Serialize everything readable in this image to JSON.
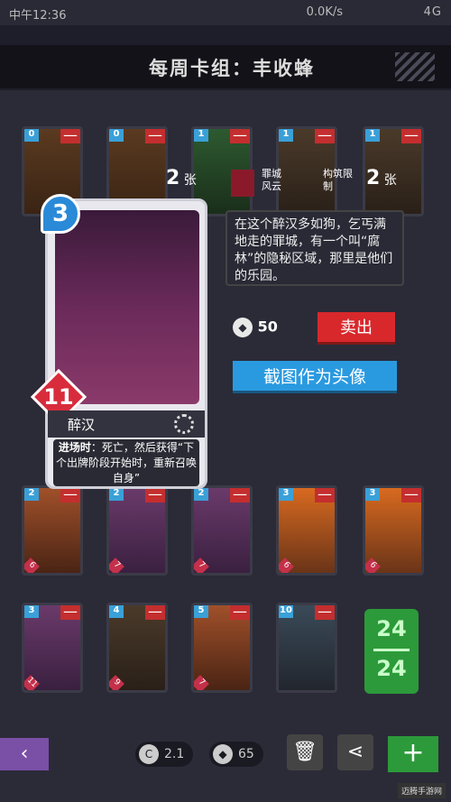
{
  "status": {
    "time": "中午12:36",
    "net": "0.0K/s",
    "right": "4G"
  },
  "title": "每周卡组：丰收蜂",
  "info": {
    "count1": "2",
    "count1_unit": "张",
    "faction": "罪城风云",
    "limit": "构筑限制",
    "count2": "2",
    "count2_unit": "张"
  },
  "card": {
    "cost": "3",
    "power": "11",
    "name": "醉汉",
    "desc_bold": "进场时",
    "desc": "：死亡，然后获得“下个出牌阶段开始时，重新召唤自身”"
  },
  "bubble": "在这个醉汉多如狗，乞丐满地走的罪城，有一个叫“腐林”的隐秘区域，那里是他们的乐园。",
  "coins": "50",
  "sell_label": "卖出",
  "avatar_label": "截图作为头像",
  "deck_count": {
    "top": "24",
    "bottom": "24"
  },
  "stats": {
    "avg": "2.1",
    "shards": "65"
  },
  "watermark": "迈腾手游网",
  "cards": [
    {
      "cost": "0",
      "power": "",
      "cls": "c-gold"
    },
    {
      "cost": "0",
      "power": "",
      "cls": "c-gold"
    },
    {
      "cost": "1",
      "power": "",
      "cls": "c-green"
    },
    {
      "cost": "1",
      "power": "",
      "cls": "c-dark"
    },
    {
      "cost": "1",
      "power": "",
      "cls": "c-dark"
    },
    {
      "cost": "2",
      "power": "6",
      "cls": "c-red"
    },
    {
      "cost": "2",
      "power": "7",
      "cls": "c-pink"
    },
    {
      "cost": "2",
      "power": "7",
      "cls": "c-pink"
    },
    {
      "cost": "3",
      "power": "6",
      "cls": "c-nuke"
    },
    {
      "cost": "3",
      "power": "6",
      "cls": "c-nuke"
    },
    {
      "cost": "3",
      "power": "11",
      "cls": "c-pink"
    },
    {
      "cost": "4",
      "power": "9",
      "cls": "c-dark"
    },
    {
      "cost": "5",
      "power": "7",
      "cls": "c-red"
    },
    {
      "cost": "10",
      "power": "",
      "cls": "c-gray"
    }
  ]
}
